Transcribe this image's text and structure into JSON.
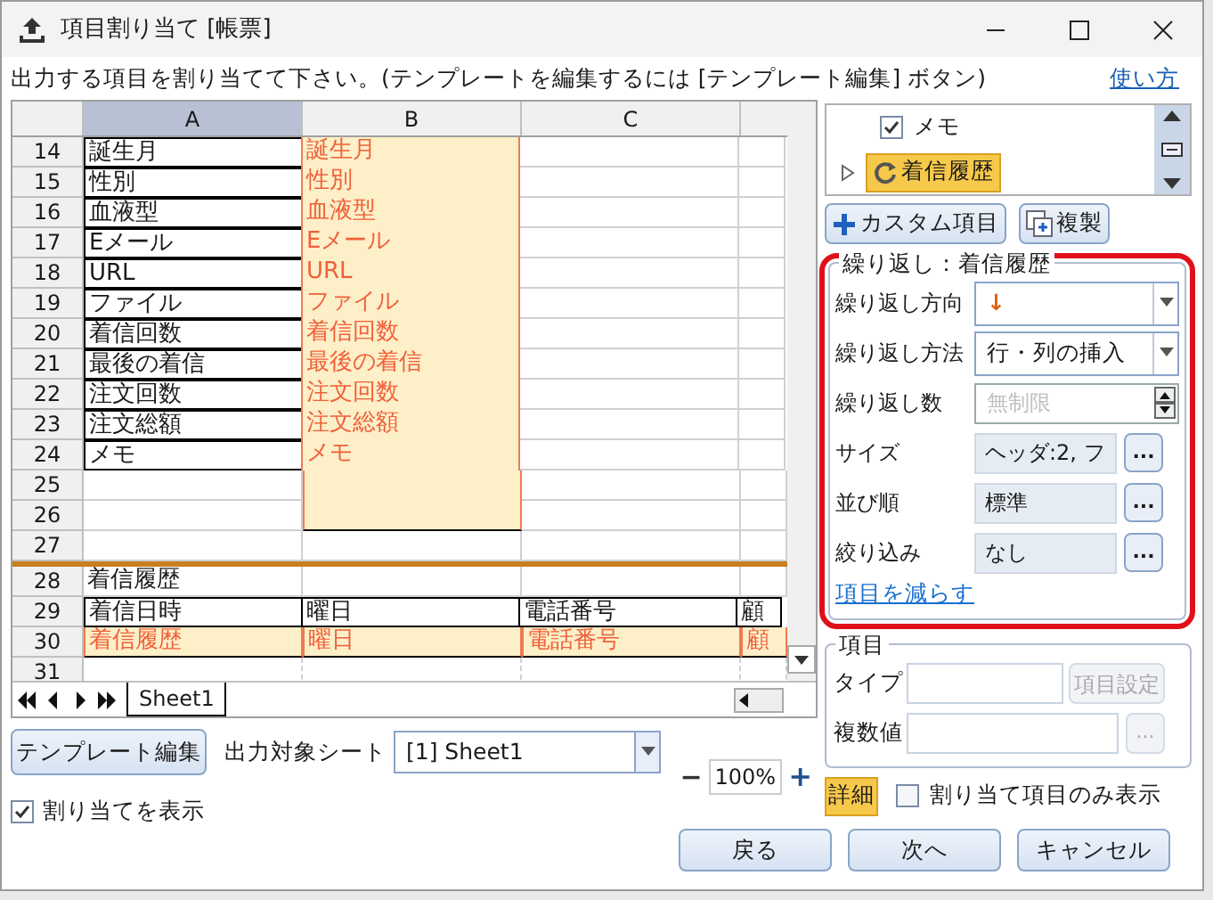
{
  "window": {
    "title": "項目割り当て [帳票]"
  },
  "instruction": "出力する項目を割り当てて下さい。(テンプレートを編集するには [テンプレート編集] ボタン)",
  "help_link": "使い方",
  "sheet": {
    "columns": [
      {
        "label": "A",
        "selected": true
      },
      {
        "label": "B",
        "selected": false
      },
      {
        "label": "C",
        "selected": false
      }
    ],
    "rows": [
      {
        "number": "14",
        "kind": "normal",
        "cells": [
          {
            "kind": "field",
            "text": "誕生月"
          },
          {
            "kind": "assigned",
            "text": "誕生月"
          },
          {
            "kind": "empty"
          },
          {
            "kind": "empty"
          }
        ]
      },
      {
        "number": "15",
        "kind": "normal",
        "cells": [
          {
            "kind": "field",
            "text": "性別"
          },
          {
            "kind": "assigned",
            "text": "性別"
          },
          {
            "kind": "empty"
          },
          {
            "kind": "empty"
          }
        ]
      },
      {
        "number": "16",
        "kind": "normal",
        "cells": [
          {
            "kind": "field",
            "text": "血液型"
          },
          {
            "kind": "assigned",
            "text": "血液型"
          },
          {
            "kind": "empty"
          },
          {
            "kind": "empty"
          }
        ]
      },
      {
        "number": "17",
        "kind": "normal",
        "cells": [
          {
            "kind": "field",
            "text": "Eメール"
          },
          {
            "kind": "assigned",
            "text": "Eメール"
          },
          {
            "kind": "empty"
          },
          {
            "kind": "empty"
          }
        ]
      },
      {
        "number": "18",
        "kind": "normal",
        "cells": [
          {
            "kind": "field",
            "text": "URL"
          },
          {
            "kind": "assigned",
            "text": "URL"
          },
          {
            "kind": "empty"
          },
          {
            "kind": "empty"
          }
        ]
      },
      {
        "number": "19",
        "kind": "normal",
        "cells": [
          {
            "kind": "field",
            "text": "ファイル"
          },
          {
            "kind": "assigned",
            "text": "ファイル"
          },
          {
            "kind": "empty"
          },
          {
            "kind": "empty"
          }
        ]
      },
      {
        "number": "20",
        "kind": "normal",
        "cells": [
          {
            "kind": "field",
            "text": "着信回数"
          },
          {
            "kind": "assigned",
            "text": "着信回数"
          },
          {
            "kind": "empty"
          },
          {
            "kind": "empty"
          }
        ]
      },
      {
        "number": "21",
        "kind": "normal",
        "cells": [
          {
            "kind": "field",
            "text": "最後の着信"
          },
          {
            "kind": "assigned",
            "text": "最後の着信"
          },
          {
            "kind": "empty"
          },
          {
            "kind": "empty"
          }
        ]
      },
      {
        "number": "22",
        "kind": "normal",
        "cells": [
          {
            "kind": "field",
            "text": "注文回数"
          },
          {
            "kind": "assigned",
            "text": "注文回数"
          },
          {
            "kind": "empty"
          },
          {
            "kind": "empty"
          }
        ]
      },
      {
        "number": "23",
        "kind": "normal",
        "cells": [
          {
            "kind": "field",
            "text": "注文総額"
          },
          {
            "kind": "assigned",
            "text": "注文総額"
          },
          {
            "kind": "empty"
          },
          {
            "kind": "empty"
          }
        ]
      },
      {
        "number": "24",
        "kind": "normal",
        "cells": [
          {
            "kind": "field",
            "text": "メモ"
          },
          {
            "kind": "assigned",
            "text": "メモ"
          },
          {
            "kind": "empty"
          },
          {
            "kind": "empty"
          }
        ]
      },
      {
        "number": "25",
        "kind": "normal",
        "cells": [
          {
            "kind": "empty"
          },
          {
            "kind": "assigned"
          },
          {
            "kind": "empty"
          },
          {
            "kind": "empty"
          }
        ]
      },
      {
        "number": "26",
        "kind": "normal",
        "cells": [
          {
            "kind": "empty"
          },
          {
            "kind": "assigned"
          },
          {
            "kind": "empty"
          },
          {
            "kind": "empty"
          }
        ]
      },
      {
        "number": "27",
        "kind": "normal",
        "cells": [
          {
            "kind": "empty"
          },
          {
            "kind": "empty"
          },
          {
            "kind": "empty"
          },
          {
            "kind": "empty"
          }
        ]
      },
      {
        "number": "28",
        "kind": "repeat_start",
        "cells": [
          {
            "kind": "text",
            "text": "着信履歴"
          },
          {
            "kind": "empty"
          },
          {
            "kind": "empty"
          },
          {
            "kind": "empty"
          }
        ]
      },
      {
        "number": "29",
        "kind": "normal",
        "cells": [
          {
            "kind": "field",
            "text": "着信日時"
          },
          {
            "kind": "field",
            "text": "曜日"
          },
          {
            "kind": "field",
            "text": "電話番号"
          },
          {
            "kind": "field",
            "text": "顧"
          }
        ]
      },
      {
        "number": "30",
        "kind": "normal",
        "cells": [
          {
            "kind": "assigned",
            "text": "着信履歴"
          },
          {
            "kind": "assigned",
            "text": "曜日"
          },
          {
            "kind": "assigned",
            "text": "電話番号"
          },
          {
            "kind": "assigned",
            "text": "顧"
          }
        ]
      },
      {
        "number": "31",
        "kind": "repeat_end",
        "cells": [
          {
            "kind": "empty"
          },
          {
            "kind": "empty"
          },
          {
            "kind": "empty"
          },
          {
            "kind": "empty"
          }
        ]
      }
    ],
    "tabs": [
      {
        "label": "Sheet1",
        "selected": true
      }
    ]
  },
  "template_button": "テンプレート編集",
  "target_sheet": {
    "label": "出力対象シート",
    "value": "[1] Sheet1"
  },
  "zoom": {
    "minus": "−",
    "value": "100%",
    "plus": "+"
  },
  "show_assignments": {
    "label": "割り当てを表示",
    "checked": true
  },
  "tree": [
    {
      "label": "メモ",
      "kind": "check",
      "checked": true,
      "selected": false
    },
    {
      "label": "着信履歴",
      "kind": "repeat",
      "selected": true
    }
  ],
  "custom_button": "カスタム項目",
  "duplicate_button": "複製",
  "repeat_group": {
    "title": "繰り返し：着信履歴",
    "rows": [
      {
        "label": "繰り返し方向",
        "kind": "select",
        "value": "↓"
      },
      {
        "label": "繰り返し方法",
        "kind": "select",
        "value": "行・列の挿入"
      },
      {
        "label": "繰り返し数",
        "kind": "spinner",
        "placeholder": "無制限"
      },
      {
        "label": "サイズ",
        "kind": "browse",
        "value": "ヘッダ:2, フ",
        "button": "..."
      },
      {
        "label": "並び順",
        "kind": "browse",
        "value": "標準",
        "button": "..."
      },
      {
        "label": "絞り込み",
        "kind": "browse",
        "value": "なし",
        "button": "..."
      }
    ],
    "link": "項目を減らす"
  },
  "item_group": {
    "title": "項目",
    "type_label": "タイプ",
    "settings_button": "項目設定",
    "multi_label": "複数値",
    "multi_button": "..."
  },
  "detail_toggle": {
    "label": "詳細",
    "on": true
  },
  "only_assigned": {
    "label": "割り当て項目のみ表示",
    "checked": false
  },
  "buttons": [
    "戻る",
    "次へ",
    "キャンセル"
  ]
}
